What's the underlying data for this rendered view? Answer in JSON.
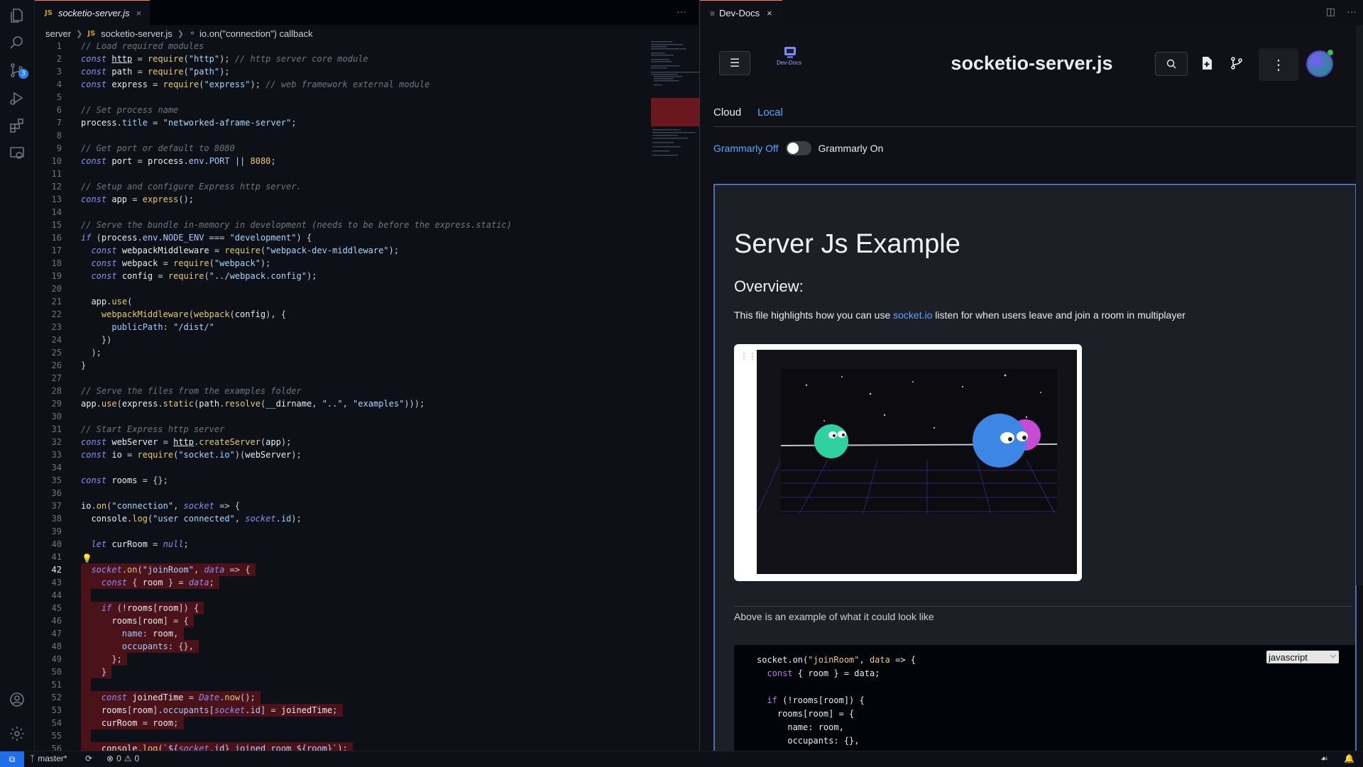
{
  "editor": {
    "tab": {
      "badge": "JS",
      "title": "socketio-server.js",
      "close": "×"
    },
    "more": "···",
    "breadcrumb": {
      "folder": "server",
      "badge": "JS",
      "file": "socketio-server.js",
      "symbol": "io.on(\"connection\") callback"
    }
  },
  "activity": {
    "scm_badge": "3"
  },
  "docs": {
    "tab_title": "Dev-Docs",
    "tab_close": "×",
    "logo_text": "Dev-Docs",
    "title": "socketio-server.js",
    "tabs": [
      "Cloud",
      "Local"
    ],
    "active_tab": "Local",
    "grammarly_off": "Grammarly Off",
    "grammarly_on": "Grammarly On",
    "doc_heading": "Server Js Example",
    "overview_heading": "Overview:",
    "overview_pre": "This file highlights how you can use ",
    "overview_link": "socket.io",
    "overview_post": " listen for when users leave and join a room in multiplayer",
    "caption": "Above is an example of what it could look like",
    "code_language": "javascript"
  },
  "statusbar": {
    "branch": "master*",
    "errors": "0",
    "warnings": "0"
  },
  "colors": {
    "accent": "#2f81f7",
    "link": "#58a6ff",
    "highlight": "#7a1b24"
  }
}
